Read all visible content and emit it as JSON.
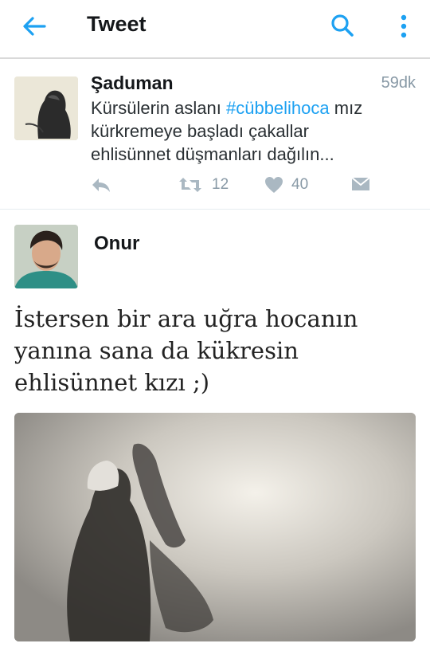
{
  "appbar": {
    "title": "Tweet",
    "back_icon": "arrow-left-icon",
    "search_icon": "search-icon",
    "more_icon": "more-vertical-icon",
    "accent": "#1da1f2"
  },
  "quoted_tweet": {
    "author": "Şaduman",
    "time": "59dk",
    "text_before_hashtag": "Kürsülerin aslanı ",
    "hashtag": "#cübbelihoca",
    "text_after_hashtag": " mız\nkürkremeye başladı çakallar\nehlisünnet düşmanları dağılın...",
    "actions": {
      "reply_icon": "reply-icon",
      "retweet_icon": "retweet-icon",
      "retweet_count": "12",
      "like_icon": "heart-icon",
      "like_count": "40",
      "dm_icon": "envelope-icon"
    }
  },
  "reply_tweet": {
    "author": "Onur",
    "text_lines": [
      "İstersen bir ara uğra hocanın",
      "yanına sana da kükresin",
      "ehlisünnet kızı ;)"
    ]
  }
}
